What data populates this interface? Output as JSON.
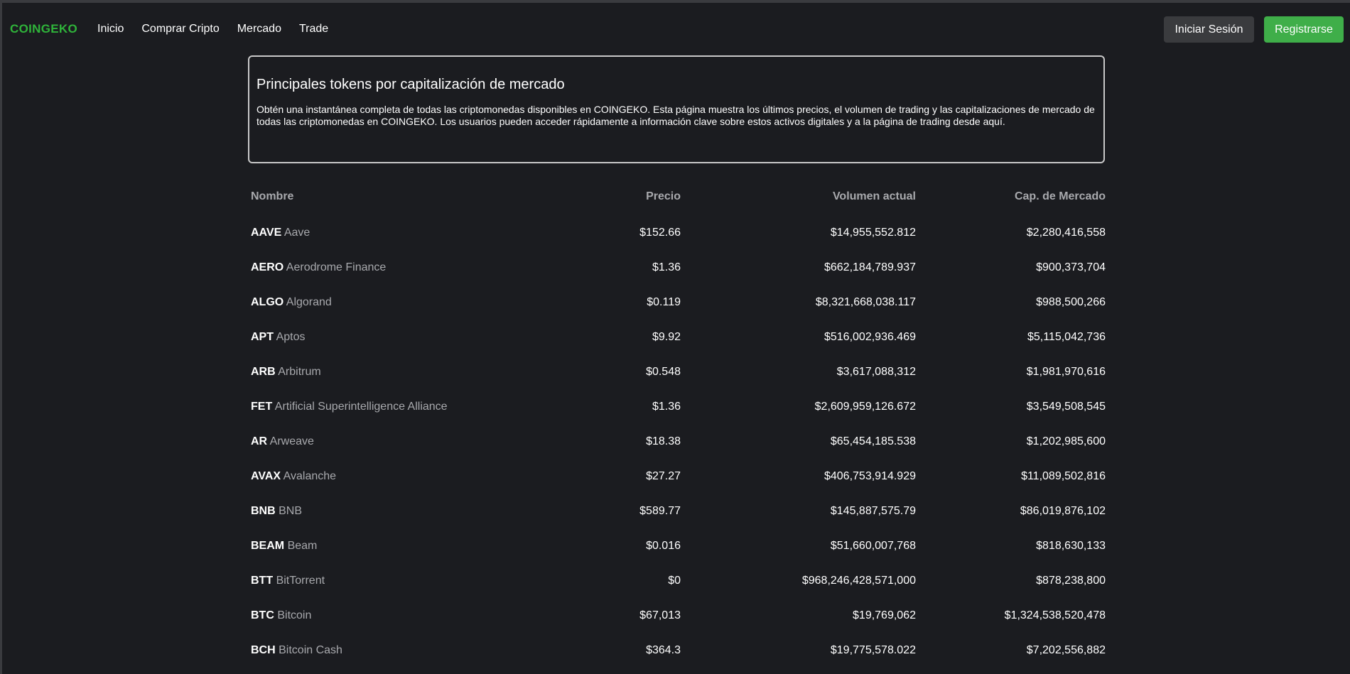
{
  "header": {
    "brand": "COINGEKO",
    "nav": [
      "Inicio",
      "Comprar Cripto",
      "Mercado",
      "Trade"
    ],
    "login_label": "Iniciar Sesión",
    "register_label": "Registrarse"
  },
  "intro": {
    "title": "Principales tokens por capitalización de mercado",
    "description": "Obtén una instantánea completa de todas las criptomonedas disponibles en COINGEKO. Esta página muestra los últimos precios, el volumen de trading y las capitalizaciones de mercado de todas las criptomonedas en COINGEKO. Los usuarios pueden acceder rápidamente a información clave sobre estos activos digitales y a la página de trading desde aquí."
  },
  "table": {
    "columns": [
      "Nombre",
      "Precio",
      "Volumen actual",
      "Cap. de Mercado"
    ],
    "rows": [
      {
        "symbol": "AAVE",
        "name": "Aave",
        "price": "$152.66",
        "volume": "$14,955,552.812",
        "cap": "$2,280,416,558"
      },
      {
        "symbol": "AERO",
        "name": "Aerodrome Finance",
        "price": "$1.36",
        "volume": "$662,184,789.937",
        "cap": "$900,373,704"
      },
      {
        "symbol": "ALGO",
        "name": "Algorand",
        "price": "$0.119",
        "volume": "$8,321,668,038.117",
        "cap": "$988,500,266"
      },
      {
        "symbol": "APT",
        "name": "Aptos",
        "price": "$9.92",
        "volume": "$516,002,936.469",
        "cap": "$5,115,042,736"
      },
      {
        "symbol": "ARB",
        "name": "Arbitrum",
        "price": "$0.548",
        "volume": "$3,617,088,312",
        "cap": "$1,981,970,616"
      },
      {
        "symbol": "FET",
        "name": "Artificial Superintelligence Alliance",
        "price": "$1.36",
        "volume": "$2,609,959,126.672",
        "cap": "$3,549,508,545"
      },
      {
        "symbol": "AR",
        "name": "Arweave",
        "price": "$18.38",
        "volume": "$65,454,185.538",
        "cap": "$1,202,985,600"
      },
      {
        "symbol": "AVAX",
        "name": "Avalanche",
        "price": "$27.27",
        "volume": "$406,753,914.929",
        "cap": "$11,089,502,816"
      },
      {
        "symbol": "BNB",
        "name": "BNB",
        "price": "$589.77",
        "volume": "$145,887,575.79",
        "cap": "$86,019,876,102"
      },
      {
        "symbol": "BEAM",
        "name": "Beam",
        "price": "$0.016",
        "volume": "$51,660,007,768",
        "cap": "$818,630,133"
      },
      {
        "symbol": "BTT",
        "name": "BitTorrent",
        "price": "$0",
        "volume": "$968,246,428,571,000",
        "cap": "$878,238,800"
      },
      {
        "symbol": "BTC",
        "name": "Bitcoin",
        "price": "$67,013",
        "volume": "$19,769,062",
        "cap": "$1,324,538,520,478"
      },
      {
        "symbol": "BCH",
        "name": "Bitcoin Cash",
        "price": "$364.3",
        "volume": "$19,775,578.022",
        "cap": "$7,202,556,882"
      }
    ]
  },
  "colors": {
    "background": "#1b1c20",
    "brand": "#2fb33a",
    "register_button": "#3fae49",
    "login_button": "#3a3b3e",
    "muted_text": "#a8a9ad"
  }
}
